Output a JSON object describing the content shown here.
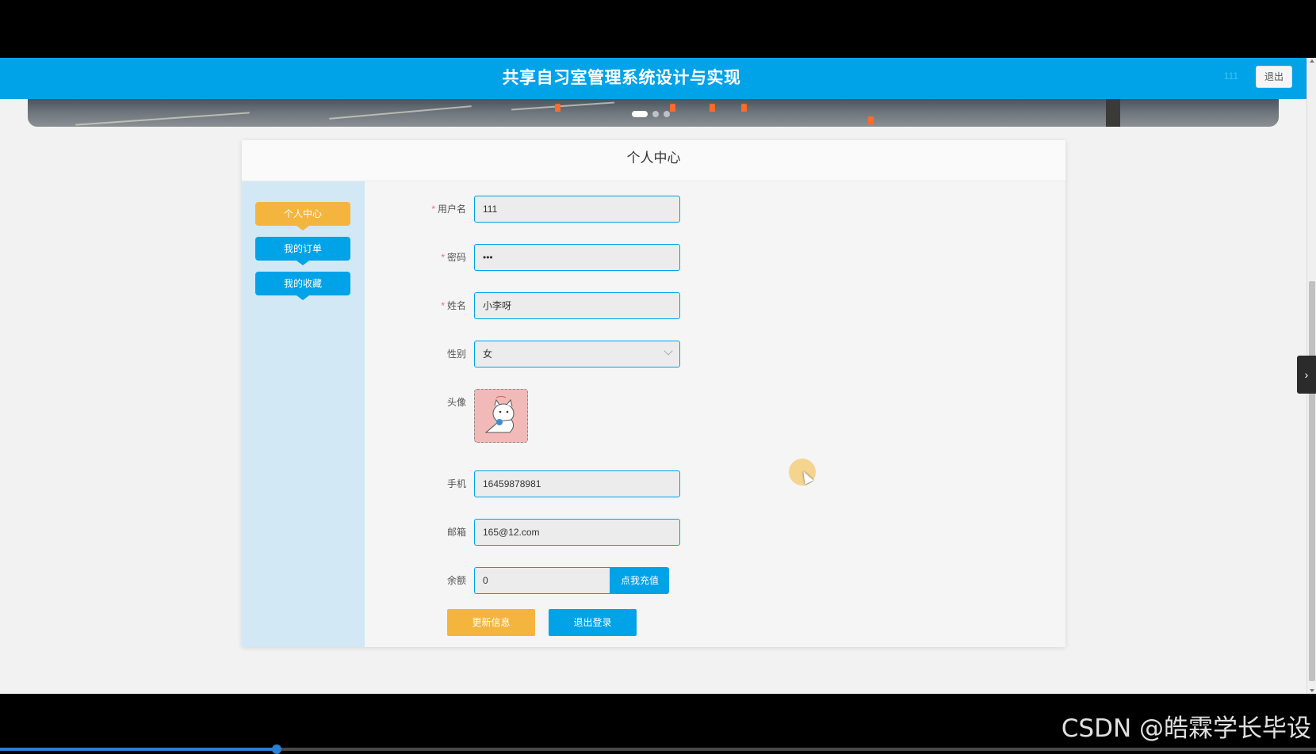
{
  "header": {
    "title": "共享自习室管理系统设计与实现",
    "username": "111",
    "logout_label": "退出"
  },
  "page": {
    "title": "个人中心"
  },
  "sidebar": {
    "items": [
      {
        "label": "个人中心",
        "active": true
      },
      {
        "label": "我的订单",
        "active": false
      },
      {
        "label": "我的收藏",
        "active": false
      }
    ]
  },
  "form": {
    "username": {
      "label": "用户名",
      "required": "*",
      "value": "111"
    },
    "password": {
      "label": "密码",
      "required": "*",
      "value": "•••"
    },
    "name": {
      "label": "姓名",
      "required": "*",
      "value": "小李呀"
    },
    "gender": {
      "label": "性别",
      "value": "女"
    },
    "avatar": {
      "label": "头像"
    },
    "phone": {
      "label": "手机",
      "value": "16459878981"
    },
    "email": {
      "label": "邮箱",
      "value": "165@12.com"
    },
    "balance": {
      "label": "余额",
      "value": "0",
      "recharge_label": "点我充值"
    },
    "update_label": "更新信息",
    "logout_label": "退出登录"
  },
  "colors": {
    "primary": "#00a2e8",
    "accent": "#f4b53f",
    "sidebar_bg": "#d2e8f5"
  },
  "carousel": {
    "slides": 3,
    "active_index": 0
  },
  "watermark": "CSDN @皓霖学长毕设",
  "video_progress": 0.21
}
